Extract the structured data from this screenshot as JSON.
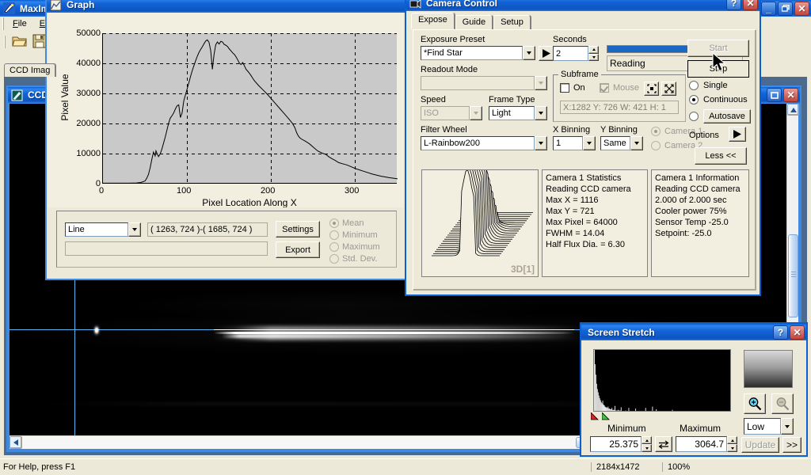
{
  "app": {
    "title": "MaxIm",
    "menu": [
      "File",
      "E"
    ],
    "toolbar_icons": [
      "open-folder-icon",
      "save-disk-icon"
    ],
    "tab_label": "CCD Imag",
    "statusbar": {
      "hint": "For Help, press F1",
      "dimensions": "2184x1472",
      "zoom": "100%"
    }
  },
  "ccd_window": {
    "title": "CCD",
    "icon": "image-document-icon"
  },
  "graph_window": {
    "title": "Graph",
    "icon": "graph-icon",
    "chart_data": {
      "type": "line",
      "title": "",
      "xlabel": "Pixel Location Along X",
      "ylabel": "Pixel Value",
      "xlim": [
        0,
        350
      ],
      "ylim": [
        0,
        50000
      ],
      "xticks": [
        0,
        100,
        200,
        300
      ],
      "yticks": [
        0,
        10000,
        20000,
        30000,
        40000,
        50000
      ],
      "grid": true,
      "legend": "none",
      "x": [
        0,
        10,
        20,
        30,
        40,
        45,
        50,
        52,
        54,
        56,
        58,
        60,
        62,
        63,
        64,
        66,
        68,
        70,
        72,
        74,
        76,
        78,
        80,
        82,
        84,
        86,
        88,
        90,
        92,
        94,
        96,
        98,
        100,
        102,
        104,
        106,
        108,
        110,
        112,
        114,
        116,
        118,
        120,
        122,
        124,
        126,
        128,
        130,
        132,
        134,
        136,
        138,
        140,
        142,
        144,
        146,
        148,
        150,
        152,
        154,
        156,
        158,
        160,
        162,
        164,
        166,
        168,
        170,
        172,
        174,
        176,
        178,
        180,
        185,
        190,
        195,
        200,
        205,
        210,
        215,
        220,
        225,
        228,
        230,
        232,
        234,
        236,
        240,
        245,
        250,
        255,
        260,
        265,
        268,
        272,
        276,
        280,
        285,
        290,
        295,
        300,
        310,
        320,
        330,
        340,
        350
      ],
      "y": [
        150,
        150,
        160,
        170,
        220,
        400,
        900,
        1800,
        3000,
        5200,
        8000,
        10500,
        9200,
        10900,
        10200,
        9000,
        9900,
        11500,
        13500,
        15500,
        17800,
        20100,
        21800,
        22600,
        23500,
        24800,
        25900,
        26200,
        22000,
        23500,
        27500,
        29500,
        31500,
        33500,
        35600,
        37500,
        39200,
        40800,
        42300,
        43600,
        44600,
        45500,
        46500,
        47400,
        47800,
        47000,
        44200,
        38000,
        43000,
        46200,
        47100,
        46400,
        47300,
        47100,
        46300,
        46000,
        45600,
        44800,
        44200,
        43500,
        43000,
        42200,
        41200,
        40100,
        39600,
        40300,
        39200,
        38000,
        37400,
        36700,
        35900,
        35000,
        34200,
        32600,
        31200,
        29800,
        28200,
        26600,
        25000,
        23400,
        21800,
        20100,
        18600,
        17000,
        15900,
        15200,
        14800,
        14200,
        13300,
        12100,
        10900,
        10200,
        9700,
        9000,
        8300,
        7700,
        7000,
        6600,
        6200,
        5600,
        5000,
        4100,
        3200,
        2500,
        2000,
        1600
      ]
    },
    "controls": {
      "mode_select": "Line",
      "coords": "( 1263, 724 )-( 1685, 724 )",
      "info_field": "",
      "settings_label": "Settings",
      "export_label": "Export",
      "stat_options": [
        "Mean",
        "Minimum",
        "Maximum",
        "Std. Dev."
      ],
      "stat_selected": "Mean"
    }
  },
  "camera_control": {
    "title": "Camera Control",
    "icon": "camera-icon",
    "tabs": [
      "Expose",
      "Guide",
      "Setup"
    ],
    "active_tab": "Expose",
    "expose": {
      "exposure_preset_label": "Exposure Preset",
      "exposure_preset_value": "*Find Star",
      "play_button": "play-triangle-icon",
      "readout_mode_label": "Readout Mode",
      "readout_mode_value": "",
      "speed_label": "Speed",
      "speed_value": "ISO",
      "frame_type_label": "Frame Type",
      "frame_type_value": "Light",
      "filter_wheel_label": "Filter Wheel",
      "filter_wheel_value": "L-Rainbow200",
      "seconds_label": "Seconds",
      "seconds_value": "2",
      "progress_percent": 100,
      "status_value": "Reading",
      "subframe_label": "Subframe",
      "subframe_on_label": "On",
      "subframe_on_checked": false,
      "subframe_mouse_label": "Mouse",
      "subframe_mouse_checked": true,
      "subframe_coords": "X:1282 Y:  726 W:  421 H:   1",
      "x_binning_label": "X Binning",
      "x_binning_value": "1",
      "y_binning_label": "Y Binning",
      "y_binning_value": "Same",
      "camera1_label": "Camera 1",
      "camera2_label": "Camera 2",
      "camera_selected": "Camera 1",
      "start_label": "Start",
      "stop_label": "Stop",
      "single_label": "Single",
      "continuous_label": "Continuous",
      "autosave_label": "Autosave",
      "mode_selected": "Continuous",
      "options_label": "Options",
      "less_label": "Less <<",
      "preview_label": "3D[1]"
    },
    "statistics": {
      "header": "Camera 1 Statistics",
      "lines": [
        "Reading CCD camera",
        "Max X = 1116",
        "Max Y = 721",
        "Max Pixel = 64000",
        "FWHM = 14.04",
        "Half Flux Dia. = 6.30"
      ]
    },
    "information": {
      "header": "Camera 1 Information",
      "lines": [
        "Reading CCD camera",
        "2.000 of 2.000 sec",
        "Cooler power 75%",
        "Sensor Temp -25.0",
        "Setpoint: -25.0"
      ]
    }
  },
  "screen_stretch": {
    "title": "Screen Stretch",
    "minimum_label": "Minimum",
    "maximum_label": "Maximum",
    "minimum_value": "25.375",
    "maximum_value": "3064.7",
    "swap_icon": "swap-arrows-icon",
    "mode_value": "Low",
    "zoom_in_icon": "zoom-in-icon",
    "zoom_out_icon": "zoom-out-icon",
    "update_label": "Update",
    "more_label": ">>",
    "histogram": {
      "type": "bar",
      "title": "",
      "xlabel": "",
      "ylabel": "",
      "values": [
        96,
        74,
        58,
        44,
        36,
        31,
        26,
        22,
        19,
        16,
        14,
        18,
        12,
        11,
        9,
        8,
        8,
        7,
        9,
        6,
        6,
        5,
        5,
        7,
        4,
        4,
        4,
        10,
        3,
        3,
        3,
        4,
        3,
        3,
        3,
        8,
        2,
        2,
        2,
        2,
        2,
        3,
        2,
        2,
        2,
        7,
        2,
        2,
        2,
        2,
        2,
        2,
        2,
        2,
        6,
        2,
        2,
        2,
        2,
        2,
        2,
        2,
        2,
        2,
        2,
        2,
        2,
        7,
        2,
        2,
        2,
        2,
        2,
        2,
        2,
        2,
        9,
        2,
        2,
        2,
        2,
        5,
        2,
        2,
        2,
        2,
        2,
        2,
        2,
        2,
        2,
        2,
        2,
        2,
        2,
        2,
        2,
        2,
        2,
        2,
        2,
        2,
        4,
        2,
        2,
        2,
        2,
        2,
        2,
        2,
        2,
        2,
        2,
        2,
        2,
        2,
        2,
        2,
        2,
        2,
        2,
        2,
        2,
        2,
        2,
        2,
        2,
        2,
        2,
        2,
        2,
        2,
        2,
        2,
        2,
        2,
        2,
        2,
        2,
        2,
        2,
        2,
        2,
        2,
        2,
        2,
        2,
        2,
        2,
        2,
        2,
        2,
        2,
        2,
        2,
        2,
        2,
        2,
        2,
        2,
        2,
        2,
        2,
        2,
        2,
        2,
        2,
        2,
        2,
        2,
        2,
        2,
        2,
        2,
        2,
        2,
        2,
        2,
        2,
        14
      ]
    },
    "markers": {
      "black_point": "red-marker-icon",
      "white_point": "green-marker-icon"
    }
  }
}
